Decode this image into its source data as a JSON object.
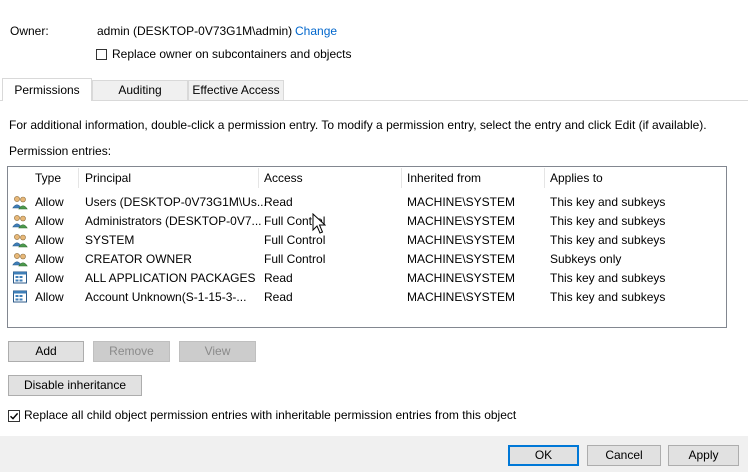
{
  "owner": {
    "label": "Owner:",
    "value": "admin (DESKTOP-0V73G1M\\admin)",
    "change_link": "Change",
    "replace_owner_label": "Replace owner on subcontainers and objects",
    "replace_owner_checked": false
  },
  "tabs": [
    {
      "label": "Permissions",
      "active": true
    },
    {
      "label": "Auditing",
      "active": false
    },
    {
      "label": "Effective Access",
      "active": false
    }
  ],
  "info_text": "For additional information, double-click a permission entry. To modify a permission entry, select the entry and click Edit (if available).",
  "entries_label": "Permission entries:",
  "columns": [
    "Type",
    "Principal",
    "Access",
    "Inherited from",
    "Applies to"
  ],
  "entries": [
    {
      "icon": "users-group-icon",
      "type": "Allow",
      "principal": "Users (DESKTOP-0V73G1M\\Us...",
      "access": "Read",
      "inherited": "MACHINE\\SYSTEM",
      "applies": "This key and subkeys"
    },
    {
      "icon": "users-group-icon",
      "type": "Allow",
      "principal": "Administrators (DESKTOP-0V7...",
      "access": "Full Control",
      "inherited": "MACHINE\\SYSTEM",
      "applies": "This key and subkeys"
    },
    {
      "icon": "users-group-icon",
      "type": "Allow",
      "principal": "SYSTEM",
      "access": "Full Control",
      "inherited": "MACHINE\\SYSTEM",
      "applies": "This key and subkeys"
    },
    {
      "icon": "users-group-icon",
      "type": "Allow",
      "principal": "CREATOR OWNER",
      "access": "Full Control",
      "inherited": "MACHINE\\SYSTEM",
      "applies": "Subkeys only"
    },
    {
      "icon": "app-packages-icon",
      "type": "Allow",
      "principal": "ALL APPLICATION PACKAGES",
      "access": "Read",
      "inherited": "MACHINE\\SYSTEM",
      "applies": "This key and subkeys"
    },
    {
      "icon": "app-packages-icon",
      "type": "Allow",
      "principal": "Account Unknown(S-1-15-3-...",
      "access": "Read",
      "inherited": "MACHINE\\SYSTEM",
      "applies": "This key and subkeys"
    }
  ],
  "buttons": {
    "add": "Add",
    "remove": "Remove",
    "view": "View",
    "disable_inheritance": "Disable inheritance",
    "ok": "OK",
    "cancel": "Cancel",
    "apply": "Apply"
  },
  "replace_child": {
    "label": "Replace all child object permission entries with inheritable permission entries from this object",
    "checked": true
  },
  "colors": {
    "link": "#0066cc",
    "default_button_border": "#0078d7",
    "footer_bg": "#f0f0f0"
  }
}
